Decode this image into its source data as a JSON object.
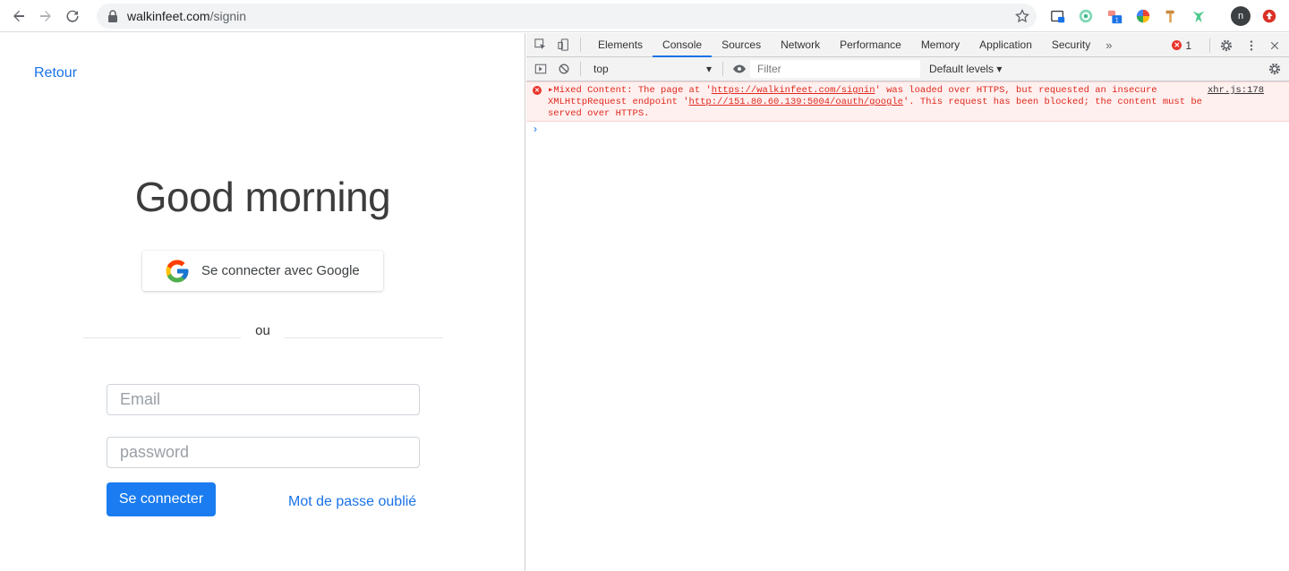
{
  "browser": {
    "url_host": "walkinfeet.com",
    "url_path": "/signin",
    "avatar_letter": "n",
    "extension_badge": "1"
  },
  "page": {
    "back_link": "Retour",
    "greeting": "Good morning",
    "google_button": "Se connecter avec Google",
    "separator": "ou",
    "email_placeholder": "Email",
    "password_placeholder": "password",
    "submit": "Se connecter",
    "forgot": "Mot de passe oublié"
  },
  "devtools": {
    "tabs": [
      "Elements",
      "Console",
      "Sources",
      "Network",
      "Performance",
      "Memory",
      "Application",
      "Security"
    ],
    "active_tab": "Console",
    "more": "»",
    "error_count": "1",
    "context": "top",
    "filter_placeholder": "Filter",
    "levels": "Default levels ▾",
    "message": {
      "part1": "▸Mixed Content: The page at '",
      "link1": "https://walkinfeet.com/signin",
      "part2": "' was loaded over HTTPS, but requested an insecure",
      "part3": "XMLHttpRequest endpoint '",
      "link2": "http://151.80.60.139:5004/oauth/google",
      "part4": "'. This request has been blocked; the content must be",
      "part5": "served over HTTPS.",
      "source": "xhr.js:178"
    },
    "prompt": "›"
  },
  "colors": {
    "link": "#1a73e8",
    "primary_button": "#1a7cf0",
    "error": "#e0281d"
  }
}
